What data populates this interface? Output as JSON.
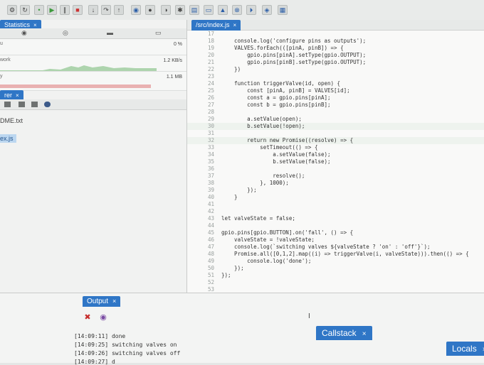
{
  "left": {
    "stats_tab": "Statistics",
    "stats_rows": [
      {
        "label": "u",
        "value": "0 %"
      },
      {
        "label": "work",
        "value": "1.2 KB/s"
      },
      {
        "label": "y",
        "value": "1.1 MB"
      }
    ],
    "explorer_tab": "rer",
    "files": [
      "DME.txt",
      "ex.js"
    ]
  },
  "editor": {
    "tab": "/src/index.js",
    "lines": [
      {
        "n": "17",
        "t": ""
      },
      {
        "n": "18",
        "t": "    console.log('configure pins as outputs');"
      },
      {
        "n": "19",
        "t": "    VALVES.forEach(([pinA, pinB]) => {"
      },
      {
        "n": "20",
        "t": "        gpio.pins[pinA].setType(gpio.OUTPUT);"
      },
      {
        "n": "21",
        "t": "        gpio.pins[pinB].setType(gpio.OUTPUT);"
      },
      {
        "n": "22",
        "t": "    })"
      },
      {
        "n": "23",
        "t": ""
      },
      {
        "n": "24",
        "t": "    function triggerValve(id, open) {"
      },
      {
        "n": "25",
        "t": "        const [pinA, pinB] = VALVES[id];"
      },
      {
        "n": "26",
        "t": "        const a = gpio.pins[pinA];"
      },
      {
        "n": "27",
        "t": "        const b = gpio.pins[pinB];"
      },
      {
        "n": "28",
        "t": ""
      },
      {
        "n": "29",
        "t": "        a.setValue(open);"
      },
      {
        "n": "30",
        "t": "        b.setValue(!open);"
      },
      {
        "n": "31",
        "t": ""
      },
      {
        "n": "32",
        "t": "        return new Promise((resolve) => {"
      },
      {
        "n": "33",
        "t": "            setTimeout(() => {"
      },
      {
        "n": "34",
        "t": "                a.setValue(false);"
      },
      {
        "n": "35",
        "t": "                b.setValue(false);"
      },
      {
        "n": "36",
        "t": ""
      },
      {
        "n": "37",
        "t": "                resolve();"
      },
      {
        "n": "38",
        "t": "            }, 1000);"
      },
      {
        "n": "39",
        "t": "        });"
      },
      {
        "n": "40",
        "t": "    }"
      },
      {
        "n": "41",
        "t": ""
      },
      {
        "n": "42",
        "t": ""
      },
      {
        "n": "43",
        "t": "let valveState = false;"
      },
      {
        "n": "44",
        "t": ""
      },
      {
        "n": "45",
        "t": "gpio.pins[gpio.BUTTON].on('fall', () => {"
      },
      {
        "n": "46",
        "t": "    valveState = !valveState;"
      },
      {
        "n": "47",
        "t": "    console.log(`switching valves ${valveState ? 'on' : 'off'}`);"
      },
      {
        "n": "48",
        "t": "    Promise.all([0,1,2].map((i) => triggerValve(i, valveState))).then(() => {"
      },
      {
        "n": "49",
        "t": "        console.log('done');"
      },
      {
        "n": "50",
        "t": "    });"
      },
      {
        "n": "51",
        "t": "});"
      },
      {
        "n": "52",
        "t": ""
      },
      {
        "n": "53",
        "t": ""
      }
    ]
  },
  "bottom": {
    "output_tab": "Output",
    "callstack_tab": "Callstack",
    "locals_tab": "Locals",
    "output_lines": [
      "[14:09:11] done",
      "[14:09:25] switching valves on",
      "[14:09:26] switching valves off",
      "[14:09:27] d"
    ]
  },
  "colors": {
    "accent": "#2f76c6",
    "keyword": "#3550c9",
    "string": "#b0403a"
  }
}
